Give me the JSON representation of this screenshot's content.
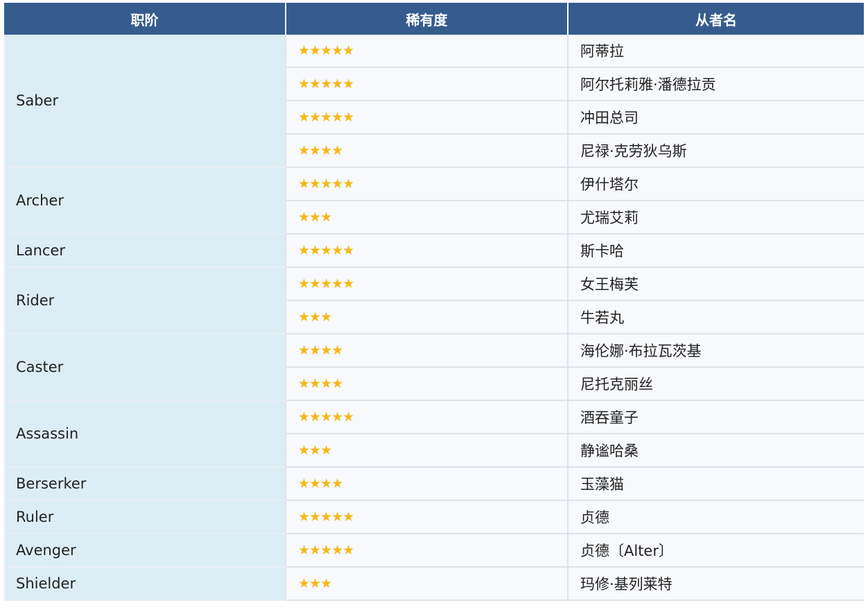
{
  "table": {
    "headers": [
      "职阶",
      "稀有度",
      "从者名"
    ],
    "groups": [
      {
        "class": "Saber",
        "rows": [
          {
            "rarity": "★★★★★",
            "name": "阿蒂拉"
          },
          {
            "rarity": "★★★★★",
            "name": "阿尔托莉雅·潘德拉贡"
          },
          {
            "rarity": "★★★★★",
            "name": "冲田总司"
          },
          {
            "rarity": "★★★★",
            "name": "尼禄·克劳狄乌斯"
          }
        ]
      },
      {
        "class": "Archer",
        "rows": [
          {
            "rarity": "★★★★★",
            "name": "伊什塔尔"
          },
          {
            "rarity": "★★★",
            "name": "尤瑞艾莉"
          }
        ]
      },
      {
        "class": "Lancer",
        "rows": [
          {
            "rarity": "★★★★★",
            "name": "斯卡哈"
          }
        ]
      },
      {
        "class": "Rider",
        "rows": [
          {
            "rarity": "★★★★★",
            "name": "女王梅芙"
          },
          {
            "rarity": "★★★",
            "name": "牛若丸"
          }
        ]
      },
      {
        "class": "Caster",
        "rows": [
          {
            "rarity": "★★★★",
            "name": "海伦娜·布拉瓦茨基"
          },
          {
            "rarity": "★★★★",
            "name": "尼托克丽丝"
          }
        ]
      },
      {
        "class": "Assassin",
        "rows": [
          {
            "rarity": "★★★★★",
            "name": "酒吞童子"
          },
          {
            "rarity": "★★★",
            "name": "静谧哈桑"
          }
        ]
      },
      {
        "class": "Berserker",
        "rows": [
          {
            "rarity": "★★★★",
            "name": "玉藻猫"
          }
        ]
      },
      {
        "class": "Ruler",
        "rows": [
          {
            "rarity": "★★★★★",
            "name": "贞德"
          }
        ]
      },
      {
        "class": "Avenger",
        "rows": [
          {
            "rarity": "★★★★★",
            "name": "贞德〔Alter〕"
          }
        ]
      },
      {
        "class": "Shielder",
        "rows": [
          {
            "rarity": "★★★",
            "name": "玛修·基列莱特"
          }
        ]
      }
    ]
  },
  "colors": {
    "header_bg": "#355c8d",
    "class_bg": "#dcedf5",
    "star": "#f5b818"
  }
}
